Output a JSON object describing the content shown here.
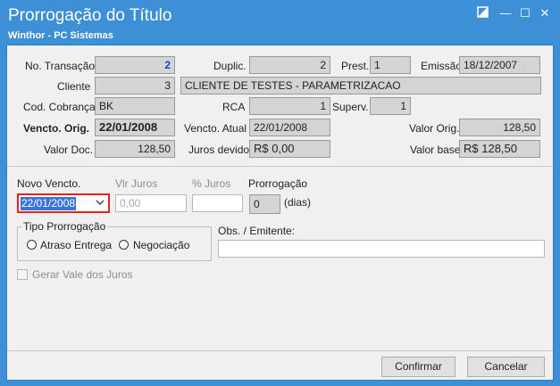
{
  "window": {
    "title": "Prorrogação do Título",
    "subtitle": "Winthor - PC Sistemas",
    "controls": {
      "restore_icon": "restore-icon",
      "minimize_glyph": "—",
      "maximize_glyph": "☐",
      "close_glyph": "✕"
    }
  },
  "info": {
    "no_transacao": {
      "label": "No. Transação",
      "value": "2"
    },
    "duplic": {
      "label": "Duplic.",
      "value": "2"
    },
    "prest": {
      "label": "Prest.",
      "value": "1"
    },
    "emissao": {
      "label": "Emissão",
      "value": "18/12/2007"
    },
    "cliente": {
      "label": "Cliente",
      "code": "3",
      "name": "CLIENTE DE TESTES - PARAMETRIZACAO"
    },
    "cod_cobranca": {
      "label": "Cod. Cobrança",
      "value": "BK"
    },
    "rca": {
      "label": "RCA",
      "value": "1"
    },
    "superv": {
      "label": "Superv.",
      "value": "1"
    },
    "vencto_orig": {
      "label": "Vencto. Orig.",
      "value": "22/01/2008"
    },
    "vencto_atual": {
      "label": "Vencto. Atual",
      "value": "22/01/2008"
    },
    "valor_orig": {
      "label": "Valor Orig.",
      "value": "128,50"
    },
    "valor_doc": {
      "label": "Valor Doc.",
      "value": "128,50"
    },
    "juros_devido": {
      "label": "Juros devido",
      "value": "R$ 0,00"
    },
    "valor_base": {
      "label": "Valor base",
      "value": "R$ 128,50"
    }
  },
  "form": {
    "novo_vencto": {
      "label": "Novo Vencto.",
      "value": "22/01/2008"
    },
    "vlr_juros": {
      "label": "Vlr Juros",
      "placeholder": "0,00"
    },
    "pct_juros": {
      "label": "% Juros",
      "value": ""
    },
    "prorrogacao": {
      "label": "Prorrogação",
      "value": "0",
      "unit": "(dias)"
    },
    "tipo_prorrogacao": {
      "label": "Tipo Prorrogação",
      "options": [
        "Atraso Entrega",
        "Negociação"
      ]
    },
    "obs": {
      "label": "Obs. / Emitente:",
      "value": ""
    },
    "gerar_vale": {
      "label": "Gerar Vale dos Juros",
      "checked": false
    }
  },
  "buttons": {
    "confirmar": "Confirmar",
    "cancelar": "Cancelar"
  }
}
